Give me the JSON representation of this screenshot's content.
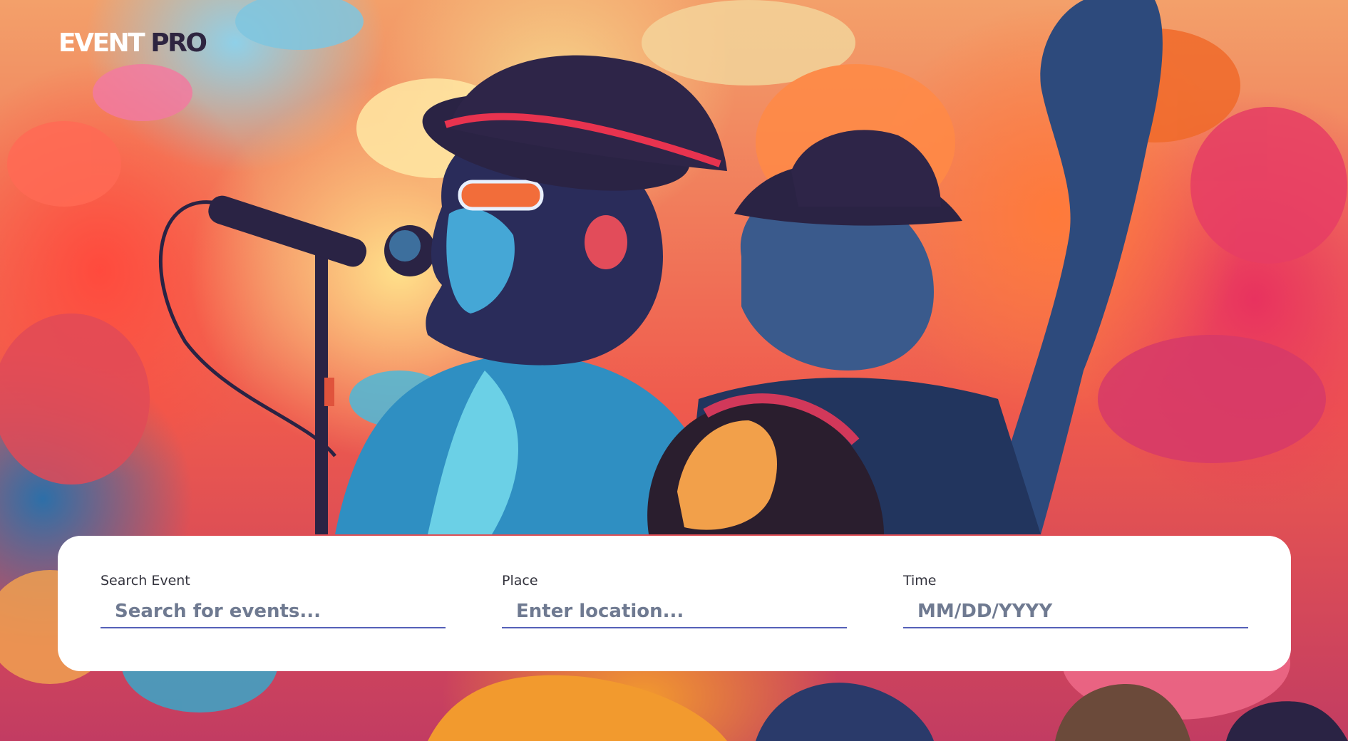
{
  "brand": {
    "logo_primary": "EVENT",
    "logo_secondary": "PRO",
    "primary_color": "#ffffff",
    "secondary_color": "#2e2540"
  },
  "hero": {
    "image_icon": "concert-singers-illustration"
  },
  "search": {
    "event": {
      "label": "Search Event",
      "placeholder": "Search for events..."
    },
    "place": {
      "label": "Place",
      "placeholder": "Enter location..."
    },
    "time": {
      "label": "Time",
      "placeholder": "MM/DD/YYYY"
    },
    "underline_color": "#5560b8"
  }
}
